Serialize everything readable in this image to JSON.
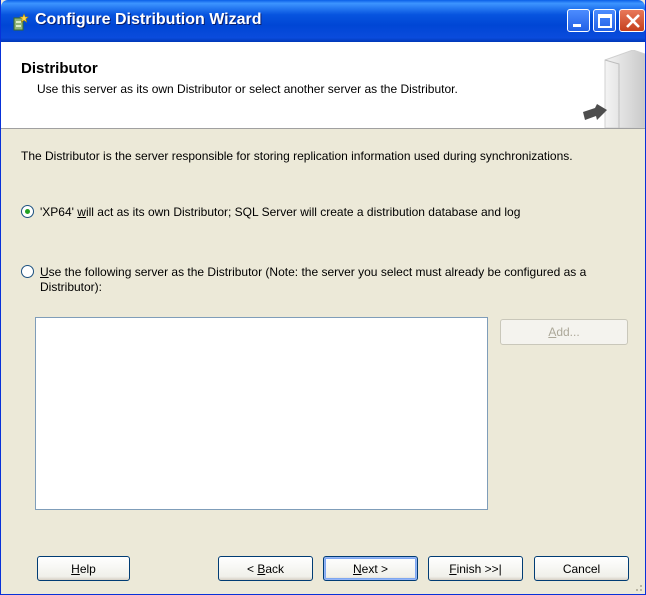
{
  "window": {
    "title": "Configure Distribution Wizard"
  },
  "header": {
    "title": "Distributor",
    "subtitle": "Use this server as its own Distributor or select another server as the Distributor."
  },
  "content": {
    "description": "The Distributor is the server responsible for storing replication information used during synchronizations.",
    "option_self": {
      "prefix": "'XP64' ",
      "accel": "w",
      "suffix": "ill act as its own Distributor; SQL Server will create a distribution database and log",
      "selected": true
    },
    "option_other": {
      "accel": "U",
      "rest": "se the following server as the Distributor (Note: the server you select must already be configured as a Distributor):",
      "selected": false
    },
    "server_list": [],
    "add_button": {
      "accel": "A",
      "rest": "dd...",
      "enabled": false
    }
  },
  "footer": {
    "help": {
      "accel": "H",
      "rest": "elp"
    },
    "back": {
      "prefix": "< ",
      "accel": "B",
      "rest": "ack"
    },
    "next": {
      "accel": "N",
      "rest": "ext >"
    },
    "finish": {
      "accel": "F",
      "rest": "inish >>|"
    },
    "cancel": "Cancel"
  },
  "colors": {
    "titlebar": "#0054e3",
    "face": "#ece9d8",
    "radio_dot": "#21a121"
  }
}
